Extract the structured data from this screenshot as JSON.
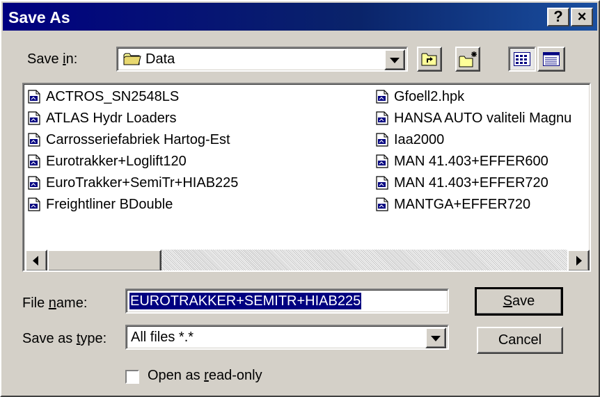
{
  "window": {
    "title": "Save As",
    "help_glyph": "?",
    "close_glyph": "×"
  },
  "save_in": {
    "label_pre": "Save ",
    "label_accel": "i",
    "label_post": "n:",
    "value": "Data"
  },
  "files": {
    "left": [
      "ACTROS_SN2548LS",
      "ATLAS Hydr Loaders",
      "Carrosseriefabriek Hartog-Est",
      "Eurotrakker+Loglift120",
      "EuroTrakker+SemiTr+HIAB225",
      "Freightliner BDouble"
    ],
    "right": [
      "Gfoell2.hpk",
      "HANSA AUTO valiteli Magnu",
      "Iaa2000",
      "MAN 41.403+EFFER600",
      "MAN 41.403+EFFER720",
      "MANTGA+EFFER720"
    ]
  },
  "filename": {
    "label_pre": "File ",
    "label_accel": "n",
    "label_post": "ame:",
    "value": "EUROTRAKKER+SEMITR+HIAB225"
  },
  "savetype": {
    "label_pre": "Save as ",
    "label_accel": "t",
    "label_post": "ype:",
    "value": "All files *.*"
  },
  "buttons": {
    "save_accel": "S",
    "save_rest": "ave",
    "cancel": "Cancel"
  },
  "readonly": {
    "label_pre": "Open as ",
    "label_accel": "r",
    "label_post": "ead-only",
    "checked": false
  },
  "colors": {
    "title_bar": "#000080",
    "face": "#d4d0c8",
    "selection": "#000080"
  }
}
